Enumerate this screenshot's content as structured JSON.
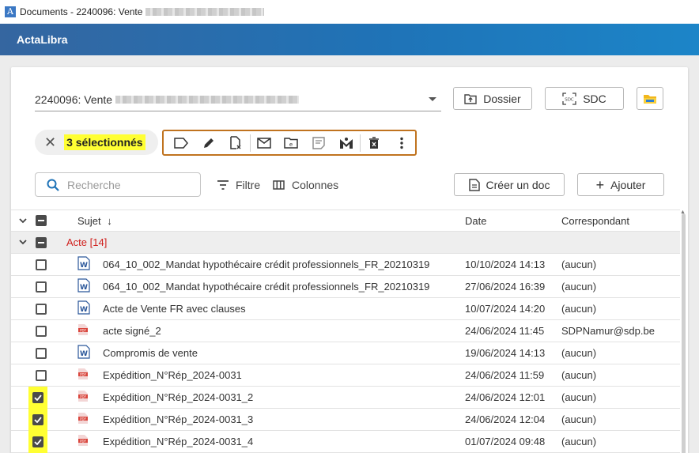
{
  "window": {
    "title": "Documents - 2240096: Vente"
  },
  "appbar": {
    "brand": "ActaLibra"
  },
  "dossier": {
    "selected": "2240096: Vente"
  },
  "buttons": {
    "dossier": "Dossier",
    "sdc": "SDC",
    "sdc_icon_text": "SDC",
    "create_doc": "Créer un doc",
    "add": "Ajouter",
    "filter": "Filtre",
    "columns": "Colonnes"
  },
  "selection": {
    "label": "3 sélectionnés"
  },
  "search": {
    "placeholder": "Recherche"
  },
  "table": {
    "headers": {
      "subject": "Sujet",
      "date": "Date",
      "correspondent": "Correspondant"
    },
    "group": {
      "label": "Acte [14]"
    },
    "rows": [
      {
        "icon": "word-doc-icon",
        "subject": "064_10_002_Mandat hypothécaire crédit professionnels_FR_20210319",
        "date": "10/10/2024 14:13",
        "correspondent": "(aucun)",
        "checked": false
      },
      {
        "icon": "word-doc-icon",
        "subject": "064_10_002_Mandat hypothécaire crédit professionnels_FR_20210319",
        "date": "27/06/2024 16:39",
        "correspondent": "(aucun)",
        "checked": false
      },
      {
        "icon": "word-doc-icon",
        "subject": "Acte de Vente FR avec clauses",
        "date": "10/07/2024 14:20",
        "correspondent": "(aucun)",
        "checked": false
      },
      {
        "icon": "pdf-icon",
        "subject": "acte signé_2",
        "date": "24/06/2024 11:45",
        "correspondent": "SDPNamur@sdp.be",
        "checked": false
      },
      {
        "icon": "word-doc-icon",
        "subject": "Compromis de vente",
        "date": "19/06/2024 14:13",
        "correspondent": "(aucun)",
        "checked": false
      },
      {
        "icon": "pdf-icon",
        "subject": "Expédition_N°Rép_2024-0031",
        "date": "24/06/2024 11:59",
        "correspondent": "(aucun)",
        "checked": false
      },
      {
        "icon": "pdf-icon",
        "subject": "Expédition_N°Rép_2024-0031_2",
        "date": "24/06/2024 12:01",
        "correspondent": "(aucun)",
        "checked": true
      },
      {
        "icon": "pdf-icon",
        "subject": "Expédition_N°Rép_2024-0031_3",
        "date": "24/06/2024 12:04",
        "correspondent": "(aucun)",
        "checked": true
      },
      {
        "icon": "pdf-icon",
        "subject": "Expédition_N°Rép_2024-0031_4",
        "date": "01/07/2024 09:48",
        "correspondent": "(aucun)",
        "checked": true
      }
    ]
  },
  "colors": {
    "accent": "#1f73b7",
    "highlight": "#ffff33",
    "group_label": "#d0201d",
    "toolbar_border": "#c0731f"
  }
}
